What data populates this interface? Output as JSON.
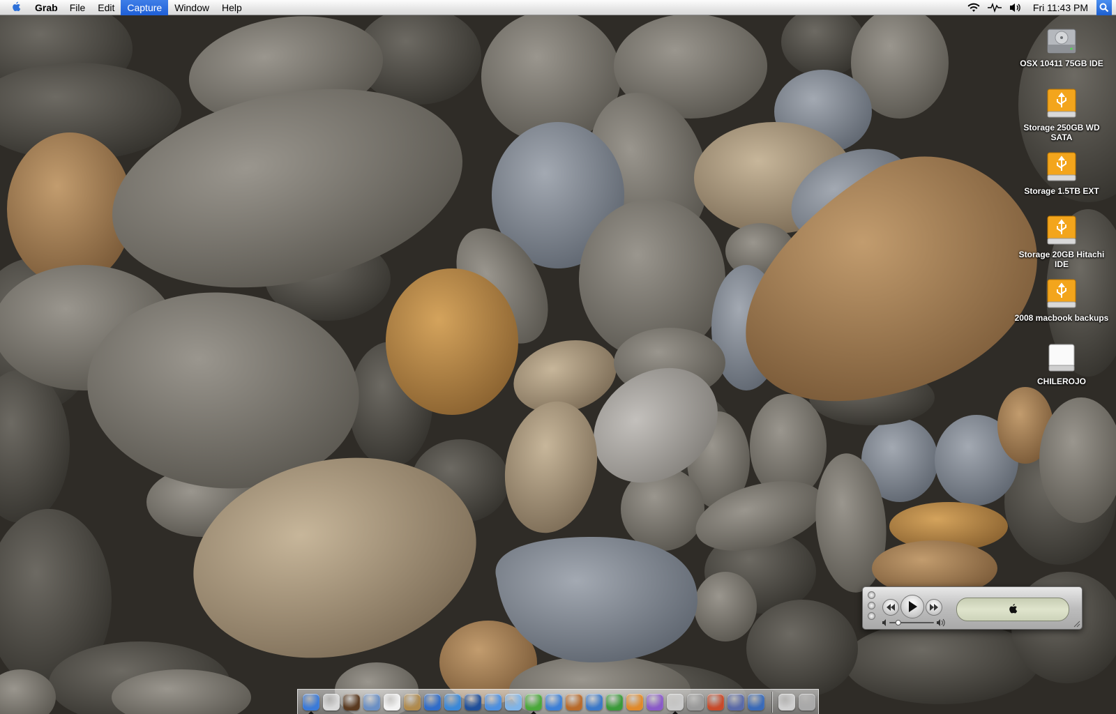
{
  "menubar": {
    "app_name": "Grab",
    "menus": [
      "File",
      "Edit",
      "Capture",
      "Window",
      "Help"
    ],
    "active_menu": "Capture",
    "clock": "Fri 11:43 PM"
  },
  "desktop": {
    "icons": [
      {
        "label": "OSX 10411 75GB IDE",
        "kind": "internal-hd"
      },
      {
        "label": "Storage 250GB WD SATA",
        "kind": "usb-drive"
      },
      {
        "label": "Storage 1.5TB EXT",
        "kind": "usb-drive"
      },
      {
        "label": "Storage 20GB Hitachi IDE",
        "kind": "usb-drive"
      },
      {
        "label": "2008 macbook backups",
        "kind": "usb-drive"
      },
      {
        "label": "CHILEROJO",
        "kind": "removable-disk"
      }
    ]
  },
  "quicktime": {
    "volume_level": 0.2
  },
  "dock": {
    "apps": [
      {
        "name": "finder",
        "color": "#3b7ad8",
        "running": true
      },
      {
        "name": "mail",
        "color": "#d9d9d9",
        "running": false
      },
      {
        "name": "dashboard",
        "color": "#5a3a20",
        "running": false
      },
      {
        "name": "preview",
        "color": "#6a8fc4",
        "running": false
      },
      {
        "name": "ical",
        "color": "#f2f2f2",
        "running": false
      },
      {
        "name": "address-book",
        "color": "#b08a4c",
        "running": false
      },
      {
        "name": "ichat-headphones",
        "color": "#2f6cc9",
        "running": false
      },
      {
        "name": "safari",
        "color": "#3a88d8",
        "running": false
      },
      {
        "name": "network",
        "color": "#1f4f9a",
        "running": false
      },
      {
        "name": "ichat",
        "color": "#4c8fe0",
        "running": false
      },
      {
        "name": "fish",
        "color": "#7fb4e8",
        "running": false
      },
      {
        "name": "itunes",
        "color": "#4aa83a",
        "running": true
      },
      {
        "name": "quicktime",
        "color": "#3c7fd6",
        "running": false
      },
      {
        "name": "garageband",
        "color": "#b86a2a",
        "running": false
      },
      {
        "name": "word",
        "color": "#3a78c8",
        "running": false
      },
      {
        "name": "excel",
        "color": "#3a9a3a",
        "running": false
      },
      {
        "name": "powerpoint",
        "color": "#e08a2a",
        "running": false
      },
      {
        "name": "entourage",
        "color": "#8a5ac8",
        "running": false
      },
      {
        "name": "grab",
        "color": "#c9c9c9",
        "running": true
      },
      {
        "name": "calculator",
        "color": "#9a9a9a",
        "running": false
      },
      {
        "name": "keynote",
        "color": "#c84a2a",
        "running": false
      },
      {
        "name": "script-editor",
        "color": "#5a6aa8",
        "running": false
      },
      {
        "name": "activity-monitor",
        "color": "#3a6ab8",
        "running": false
      }
    ],
    "right": [
      {
        "name": "documents-stack",
        "color": "#cfcfcf"
      },
      {
        "name": "trash",
        "color": "#a9a9a9"
      }
    ]
  }
}
